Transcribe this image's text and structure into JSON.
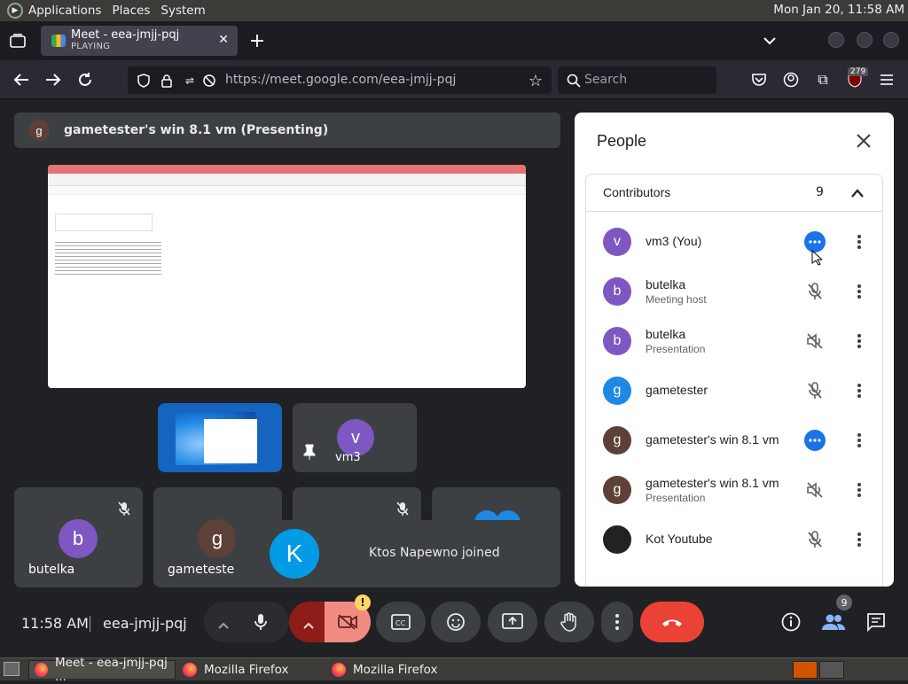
{
  "panel": {
    "menus": [
      "Applications",
      "Places",
      "System"
    ],
    "clock": "Mon Jan 20, 11:58 AM"
  },
  "browser": {
    "tab": {
      "title": "Meet - eea-jmjj-pqj",
      "status": "PLAYING"
    },
    "url": "https://meet.google.com/eea-jmjj-pqj",
    "search_placeholder": "Search",
    "ext_badge": "279"
  },
  "meet": {
    "presenting_initial": "g",
    "presenting_label": "gametester's win 8.1 vm (Presenting)",
    "tiles": [
      {
        "name": "vm3",
        "initial": "v"
      },
      {
        "name": "butelka",
        "initial": "b"
      },
      {
        "name": "gametester",
        "initial": "g"
      }
    ],
    "toast": {
      "initial": "K",
      "text": "Ktos Napewno joined"
    },
    "meeting_time": "11:58 AM",
    "meeting_code": "eea-jmjj-pqj",
    "people_count_badge": "9"
  },
  "people": {
    "title": "People",
    "section": "Contributors",
    "count": "9",
    "list": [
      {
        "name": "vm3 (You)",
        "role": "",
        "initial": "v",
        "color": "#7e57c2",
        "status": "dots"
      },
      {
        "name": "butelka",
        "role": "Meeting host",
        "initial": "b",
        "color": "#7e57c2",
        "status": "mic-off"
      },
      {
        "name": "butelka",
        "role": "Presentation",
        "initial": "b",
        "color": "#7e57c2",
        "status": "sound-off"
      },
      {
        "name": "gametester",
        "role": "",
        "initial": "g",
        "color": "#1e88e5",
        "status": "mic-off"
      },
      {
        "name": "gametester's win 8.1 vm",
        "role": "",
        "initial": "g",
        "color": "#5d4037",
        "status": "dots"
      },
      {
        "name": "gametester's win 8.1 vm",
        "role": "Presentation",
        "initial": "g",
        "color": "#5d4037",
        "status": "sound-off"
      },
      {
        "name": "Kot Youtube",
        "role": "",
        "initial": "",
        "color": "#222222",
        "status": "mic-off"
      }
    ]
  },
  "taskbar": {
    "items": [
      "Meet - eea-jmjj-pqj ...",
      "Mozilla Firefox",
      "Mozilla Firefox"
    ]
  },
  "colors": {
    "accent": "#1a73e8",
    "end_call": "#ea4335",
    "muted_red": "#8c1d18"
  }
}
